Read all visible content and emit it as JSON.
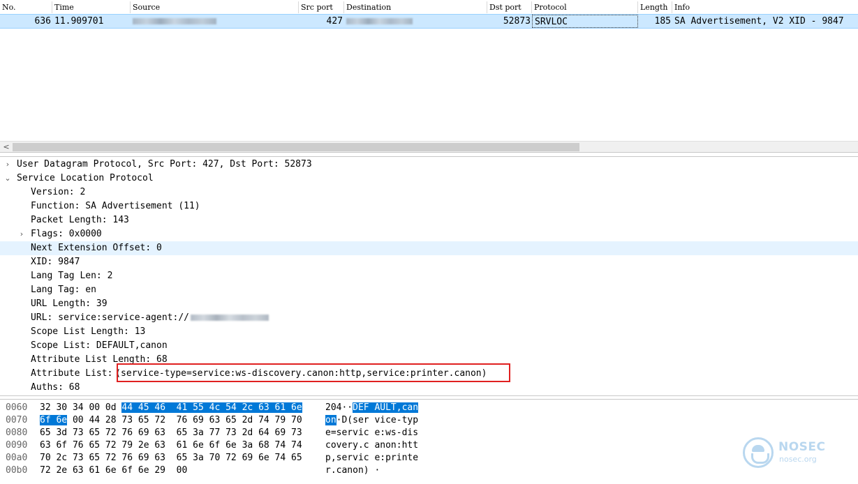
{
  "packet_list": {
    "columns": {
      "no": "No.",
      "time": "Time",
      "source": "Source",
      "src_port": "Src port",
      "destination": "Destination",
      "dst_port": "Dst port",
      "protocol": "Protocol",
      "length": "Length",
      "info": "Info"
    },
    "row": {
      "no": "636",
      "time": "11.909701",
      "src_port": "427",
      "dst_port": "52873",
      "protocol": "SRVLOC",
      "length": "185",
      "info": "SA Advertisement, V2 XID - 9847"
    }
  },
  "details": {
    "udp": "User Datagram Protocol, Src Port: 427, Dst Port: 52873",
    "slp": "Service Location Protocol",
    "fields": {
      "version": "Version: 2",
      "function": "Function: SA Advertisement (11)",
      "packet_length": "Packet Length: 143",
      "flags": "Flags: 0x0000",
      "next_ext": "Next Extension Offset: 0",
      "xid": "XID: 9847",
      "lang_tag_len": "Lang Tag Len: 2",
      "lang_tag": "Lang Tag: en",
      "url_length": "URL Length: 39",
      "url": "URL: service:service-agent://",
      "scope_list_length": "Scope List Length: 13",
      "scope_list": "Scope List: DEFAULT,canon",
      "attr_list_length": "Attribute List Length: 68",
      "attr_list_label": "Attribute List: ",
      "attr_list_value": "(service-type=service:ws-discovery.canon:http,service:printer.canon)",
      "auths": "Auths: 68"
    }
  },
  "bytes": [
    {
      "offset": "0060",
      "hex_plain_a": "32 30 34 00 0d ",
      "hex_hl_a": "44 45 46  41 55 4c 54 2c 63 61 6e",
      "hex_plain_b": "",
      "ascii_plain_a": "204··",
      "ascii_hl": "DEF AULT,can",
      "ascii_plain_b": ""
    },
    {
      "offset": "0070",
      "hex_plain_a": "",
      "hex_hl_a": "6f 6e",
      "hex_plain_b": " 00 44 28 73 65 72  76 69 63 65 2d 74 79 70",
      "ascii_plain_a": "",
      "ascii_hl": "on",
      "ascii_plain_b": "·D(ser vice-typ"
    },
    {
      "offset": "0080",
      "hex_plain_a": "65 3d 73 65 72 76 69 63  65 3a 77 73 2d 64 69 73",
      "hex_hl_a": "",
      "hex_plain_b": "",
      "ascii_plain_a": "e=servic e:ws-dis",
      "ascii_hl": "",
      "ascii_plain_b": ""
    },
    {
      "offset": "0090",
      "hex_plain_a": "63 6f 76 65 72 79 2e 63  61 6e 6f 6e 3a 68 74 74",
      "hex_hl_a": "",
      "hex_plain_b": "",
      "ascii_plain_a": "covery.c anon:htt",
      "ascii_hl": "",
      "ascii_plain_b": ""
    },
    {
      "offset": "00a0",
      "hex_plain_a": "70 2c 73 65 72 76 69 63  65 3a 70 72 69 6e 74 65",
      "hex_hl_a": "",
      "hex_plain_b": "",
      "ascii_plain_a": "p,servic e:printe",
      "ascii_hl": "",
      "ascii_plain_b": ""
    },
    {
      "offset": "00b0",
      "hex_plain_a": "72 2e 63 61 6e 6f 6e 29  00",
      "hex_hl_a": "",
      "hex_plain_b": "",
      "ascii_plain_a": "r.canon) ·",
      "ascii_hl": "",
      "ascii_plain_b": ""
    }
  ],
  "watermark": {
    "name": "NOSEC",
    "site": "nosec.org"
  },
  "icons": {
    "expand": "chevron-right-icon",
    "collapse": "chevron-down-icon",
    "scroll_left": "scroll-left-arrow-icon"
  }
}
